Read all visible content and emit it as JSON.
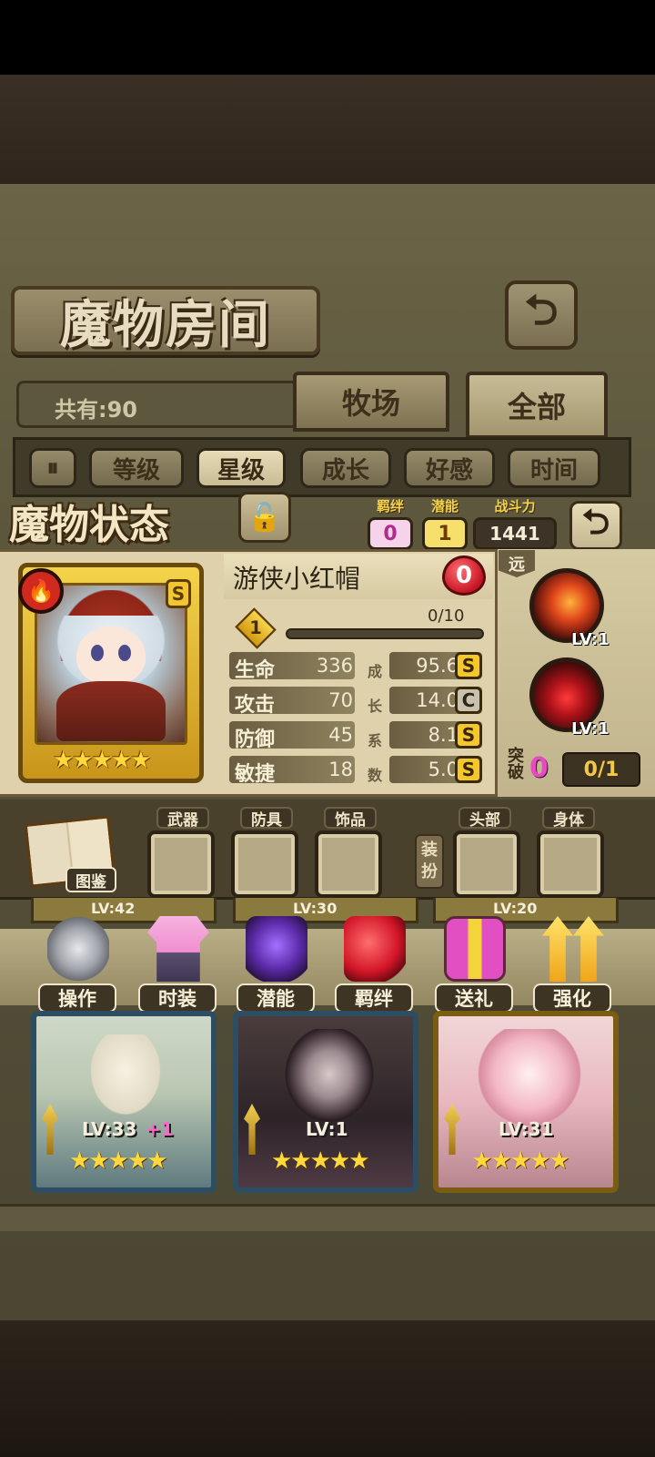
{
  "header": {
    "title": "魔物房间",
    "back_symbol": "⮌"
  },
  "count": {
    "label": "共有:90"
  },
  "tabs": [
    {
      "label": "牧场"
    },
    {
      "label": "全部"
    }
  ],
  "sort": {
    "toggle_symbol": "⏸",
    "buttons": [
      {
        "label": "等级"
      },
      {
        "label": "星级"
      },
      {
        "label": "成长"
      },
      {
        "label": "好感"
      },
      {
        "label": "时间"
      }
    ],
    "active": "星级"
  },
  "status": {
    "title": "魔物状态",
    "lock_symbol": "🔓",
    "bond": {
      "label": "羁绊",
      "value": "0"
    },
    "potential": {
      "label": "潜能",
      "value": "1"
    },
    "power": {
      "label": "战斗力",
      "value": "1441"
    },
    "back_symbol": "⮌"
  },
  "monster": {
    "name": "游侠小红帽",
    "element_symbol": "🔥",
    "rank": "S",
    "stars": "★★★★★",
    "affection": "0",
    "level": "1",
    "exp_text": "0/10",
    "exp_fraction": 0,
    "stats": [
      {
        "name": "生命",
        "value": "336",
        "growth": "95.6",
        "grade": "S"
      },
      {
        "name": "攻击",
        "value": "70",
        "growth": "14.0",
        "grade": "C"
      },
      {
        "name": "防御",
        "value": "45",
        "growth": "8.1",
        "grade": "S"
      },
      {
        "name": "敏捷",
        "value": "18",
        "growth": "5.0",
        "grade": "S"
      }
    ],
    "growth_vertical_label": [
      "成",
      "长",
      "系",
      "数"
    ]
  },
  "skills": {
    "range": "远",
    "items": [
      {
        "level": "LV:1"
      },
      {
        "level": "LV:1"
      }
    ],
    "breakthrough": {
      "label": "突破",
      "value": "0",
      "progress": "0/1"
    }
  },
  "equipment": {
    "book_label": "图鉴",
    "slots": [
      {
        "label": "武器"
      },
      {
        "label": "防具"
      },
      {
        "label": "饰品"
      }
    ],
    "dress_label": "装扮",
    "cosmetic_slots": [
      {
        "label": "头部"
      },
      {
        "label": "身体"
      }
    ]
  },
  "peek_row": [
    {
      "level": "LV:42"
    },
    {
      "level": "LV:30"
    },
    {
      "level": "LV:20"
    }
  ],
  "actions": [
    {
      "label": "操作",
      "icon": "gear-icon"
    },
    {
      "label": "时装",
      "icon": "outfit-icon"
    },
    {
      "label": "潜能",
      "icon": "potential-icon"
    },
    {
      "label": "羁绊",
      "icon": "hearts-icon"
    },
    {
      "label": "送礼",
      "icon": "gift-icon"
    },
    {
      "label": "强化",
      "icon": "upgrade-arrows-icon"
    }
  ],
  "monster_cards": [
    {
      "level": "LV:33",
      "bonus": "+1",
      "stars": "★★★★★",
      "frame_color": "#3f6c86"
    },
    {
      "level": "LV:1",
      "bonus": "",
      "stars": "★★★★★",
      "frame_color": "#3f6c86"
    },
    {
      "level": "LV:31",
      "bonus": "",
      "stars": "★★★★★",
      "frame_color": "#c7a21e"
    }
  ]
}
